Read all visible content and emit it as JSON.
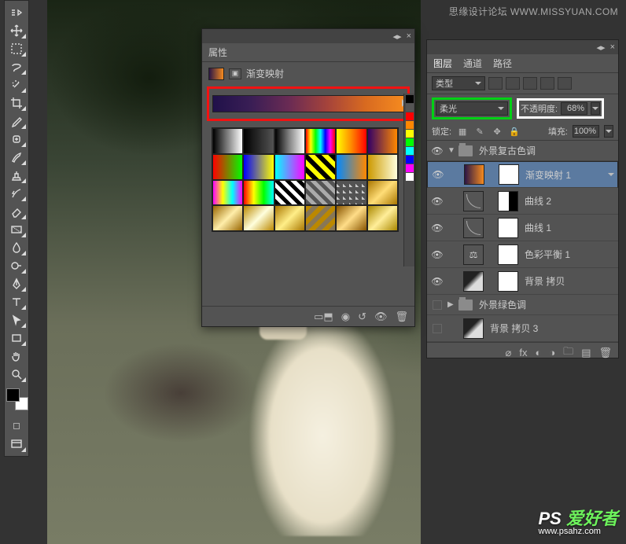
{
  "watermark": {
    "top": "思缘设计论坛  WWW.MISSYUAN.COM",
    "bottom_brand": "PS",
    "bottom_text": "爱好者",
    "bottom_url": "www.psahz.com"
  },
  "properties_panel": {
    "title": "属性",
    "adjustment_label": "渐变映射",
    "footer_icons": [
      "link",
      "clip",
      "reset",
      "view",
      "trash"
    ]
  },
  "layers_panel": {
    "tabs": [
      "图层",
      "通道",
      "路径"
    ],
    "filter_label": "类型",
    "blend_mode": "柔光",
    "opacity_label": "不透明度:",
    "opacity_value": "68%",
    "lock_label": "锁定:",
    "fill_label": "填充:",
    "fill_value": "100%",
    "layers": [
      {
        "type": "group",
        "name": "外景复古色调",
        "visible": true,
        "expanded": true
      },
      {
        "type": "adj",
        "name": "渐变映射 1",
        "visible": true,
        "selected": true,
        "thumb": "grad",
        "mask": "white"
      },
      {
        "type": "adj",
        "name": "曲线 2",
        "visible": true,
        "thumb": "curve",
        "mask": "mix"
      },
      {
        "type": "adj",
        "name": "曲线 1",
        "visible": true,
        "thumb": "curve",
        "mask": "white"
      },
      {
        "type": "adj",
        "name": "色彩平衡 1",
        "visible": true,
        "thumb": "balance",
        "mask": "white"
      },
      {
        "type": "layer",
        "name": "背景 拷贝",
        "visible": true,
        "thumb": "img",
        "mask": "white"
      },
      {
        "type": "group",
        "name": "外景绿色调",
        "visible": false,
        "expanded": false
      },
      {
        "type": "layer",
        "name": "背景 拷贝 3",
        "visible": false,
        "thumb": "img"
      }
    ],
    "footer_icons": [
      "link",
      "fx",
      "mask",
      "adj",
      "group",
      "new",
      "trash"
    ]
  },
  "gradient_presets": [
    "linear-gradient(90deg,#000,#fff)",
    "linear-gradient(90deg,#000,transparent)",
    "linear-gradient(90deg,#000,#888,#fff)",
    "linear-gradient(90deg,#f00,#ff0,#0f0,#0ff,#00f,#f0f,#f00)",
    "linear-gradient(90deg,#ff0,#f80,#f00)",
    "linear-gradient(90deg,#306,#f80)",
    "linear-gradient(90deg,#f00,#0f0)",
    "linear-gradient(90deg,#00f,#ff0)",
    "linear-gradient(90deg,#0ff,#f0f)",
    "repeating-linear-gradient(45deg,#ff0 0 6px,#000 6px 12px)",
    "linear-gradient(90deg,#08f,#f80)",
    "linear-gradient(90deg,#c90,#ffd)",
    "linear-gradient(90deg,#f0f,#ff0,#0ff,#f0f)",
    "linear-gradient(90deg,#f00,#ff0,#0f0,#0ff)",
    "repeating-linear-gradient(45deg,#000 0 5px,#fff 5px 10px)",
    "repeating-linear-gradient(45deg,#555 0 5px,#aaa 5px 10px)",
    "linear-gradient(45deg,#ccc 25%,transparent 25%) 0 0/8px 8px",
    "linear-gradient(135deg,#a70,#fd7,#a70)",
    "linear-gradient(135deg,#960,#fea,#960)",
    "linear-gradient(135deg,#b80,#ffd,#b80)",
    "linear-gradient(135deg,#a70,#fe8,#a70)",
    "repeating-linear-gradient(135deg,#b80 0 6px,#875 6px 12px)",
    "linear-gradient(135deg,#850,#fd8,#850)",
    "linear-gradient(135deg,#a80,#fe9,#a80)"
  ],
  "swatch_strip": [
    "#000",
    "#555",
    "#f00",
    "#f80",
    "#ff0",
    "#0f0",
    "#0ff",
    "#00f",
    "#f0f",
    "#fff"
  ]
}
